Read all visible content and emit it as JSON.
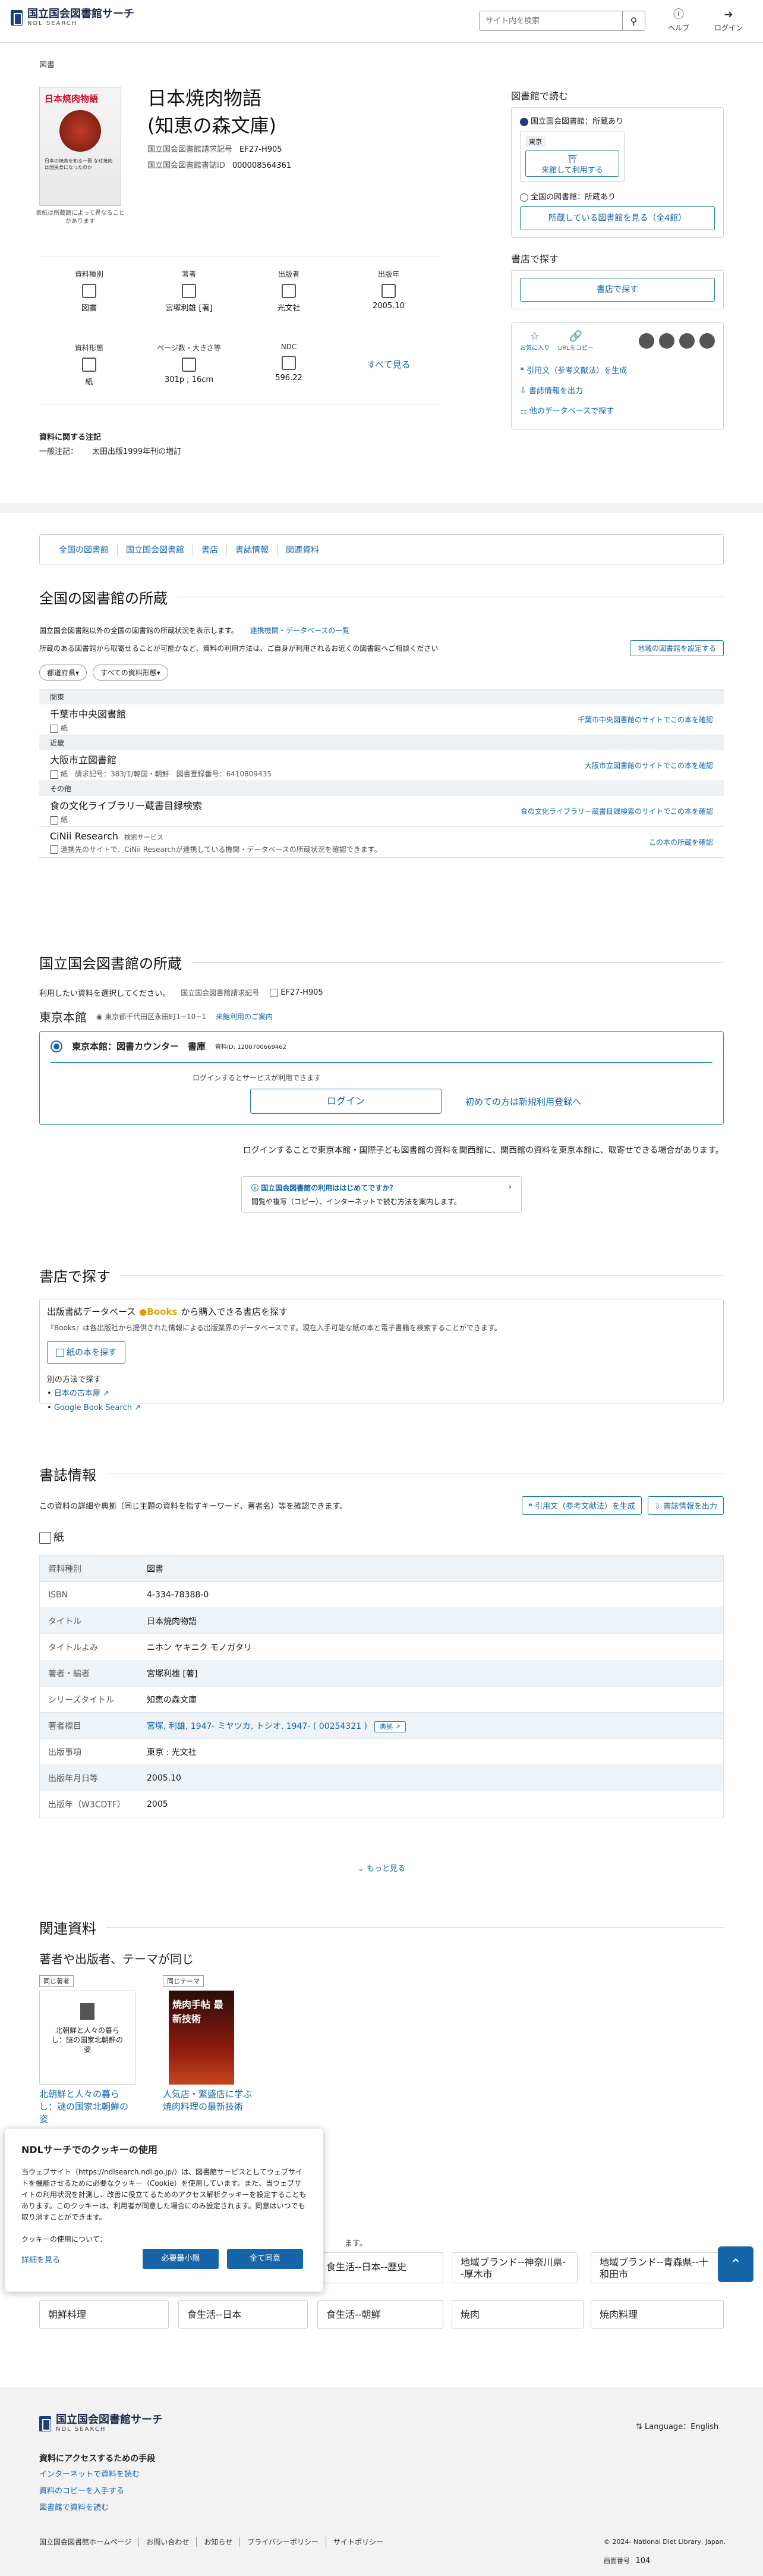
{
  "header": {
    "logo_title": "国立国会図書館サーチ",
    "logo_sub": "NDL SEARCH",
    "search_placeholder": "サイト内を検索",
    "help": "ヘルプ",
    "login": "ログイン"
  },
  "item": {
    "category": "図書",
    "title_line1": "日本焼肉物語",
    "title_line2": "(知恵の森文庫)",
    "call_label": "国立国会図書館請求記号",
    "call_value": "EF27-H905",
    "id_label": "国立国会図書館書誌ID",
    "id_value": "000008564361",
    "cover_note": "表紙は所蔵館によって異なることがあります",
    "cover_title": "日本焼肉物語",
    "cover_sub": "日本の焼肉を知る一冊 なぜ焼肉は国民食になったのか",
    "facts": [
      {
        "label": "資料種別",
        "value": "図書"
      },
      {
        "label": "著者",
        "value": "宮塚利雄 [著]"
      },
      {
        "label": "出版者",
        "value": "光文社"
      },
      {
        "label": "出版年",
        "value": "2005.10"
      },
      {
        "label": "資料形態",
        "value": "紙"
      },
      {
        "label": "ページ数・大きさ等",
        "value": "301p ; 16cm"
      },
      {
        "label": "NDC",
        "value": "596.22"
      }
    ],
    "see_all": "すべて見る",
    "notes_heading": "資料に関する注記",
    "notes_label": "一般注記：",
    "notes_value": "太田出版1999年刊の増訂"
  },
  "side": {
    "read_heading": "図書館で読む",
    "ndl_holding": "国立国会図書館：所蔵あり",
    "tokyo_tag": "東京",
    "visit_button": "来館して利用する",
    "national_holding": "全国の図書館：所蔵あり",
    "national_button": "所蔵している図書館を見る（全4館）",
    "shop_heading": "書店で探す",
    "shop_button": "書店で探す",
    "share_star": "お気に入り",
    "share_url": "URLをコピー",
    "links": [
      "引用文（参考文献法）を生成",
      "書誌情報を出力",
      "他のデータベースで探す"
    ]
  },
  "tabs": [
    "全国の図書館",
    "国立国会図書館",
    "書店",
    "書誌情報",
    "関連資料"
  ],
  "national": {
    "heading": "全国の図書館の所蔵",
    "desc": "国立国会図書館以外の全国の図書館の所蔵状況を表示します。",
    "desc_link": "連携機関・データベースの一覧",
    "desc2": "所蔵のある図書館から取寄せることが可能かなど、資料の利用方法は、ご自身が利用されるお近くの図書館へご相談ください",
    "region_button": "地域の図書館を設定する",
    "filter1": "都道府県▾",
    "filter2": "すべての資料形態▾",
    "groups": [
      {
        "group": "関東",
        "name": "千葉市中央図書館",
        "sub": "紙",
        "link": "千葉市中央図書館のサイトでこの本を確認"
      },
      {
        "group": "近畿",
        "name": "大阪市立図書館",
        "sub": "紙　請求記号：383/1/韓国・朝鮮　図書登録番号：6410809435",
        "link": "大阪市立図書館のサイトでこの本を確認"
      },
      {
        "group": "その他",
        "name": "食の文化ライブラリー蔵書目録検索",
        "sub": "紙",
        "link": "食の文化ライブラリー蔵書目録検索のサイトでこの本を確認"
      },
      {
        "group": "",
        "name": "CiNii Research",
        "sub": "連携先のサイトで、CiNii Researchが連携している機関・データベースの所蔵状況を確認できます。",
        "link": "この本の所蔵を確認",
        "badge": "検索サービス"
      }
    ]
  },
  "ndl": {
    "heading": "国立国会図書館の所蔵",
    "instruction": "利用したい資料を選択してください。",
    "call_label": "国立国会図書館請求記号",
    "call_value": "EF27-H905",
    "branch": "東京本館",
    "address": "東京都千代田区永田町1−10−1",
    "visit_info": "来館利用のご案内",
    "option_title": "東京本館：図書カウンター　書庫",
    "option_id": "資料ID: 1200700669462",
    "login_hint": "ログインするとサービスが利用できます",
    "login_button": "ログイン",
    "register_link": "初めての方は新規利用登録へ",
    "note": "ログインすることで東京本館・国際子ども図書館の資料を関西館に、関西館の資料を東京本館に、取寄せできる場合があります。",
    "guide_title": "国立国会図書館の利用ははじめてですか？",
    "guide_text": "閲覧や複写（コピー）、インターネットで読む方法を案内します。"
  },
  "shop": {
    "heading": "書店で探す",
    "db_title": "出版書誌データベース",
    "db_brand": "Books",
    "db_suffix": "から購入できる書店を探す",
    "db_desc": "『Books』は各出版社から提供された情報による出版業界のデータベースです。現在入手可能な紙の本と電子書籍を検索することができます。",
    "paper_button": "紙の本を探す",
    "alt_heading": "別の方法で探す",
    "alt_links": [
      "日本の古本屋",
      "Google Book Search"
    ]
  },
  "biblio": {
    "heading": "書誌情報",
    "desc": "この資料の詳細や典拠（同じ主題の資料を指すキーワード、著者名）等を確認できます。",
    "cite_button": "引用文（参考文献法）を生成",
    "export_button": "書誌情報を出力",
    "format": "紙",
    "rows": [
      {
        "k": "資料種別",
        "v": "図書"
      },
      {
        "k": "ISBN",
        "v": "4-334-78388-0"
      },
      {
        "k": "タイトル",
        "v": "日本焼肉物語"
      },
      {
        "k": "タイトルよみ",
        "v": "ニホン ヤキニク モノガタリ"
      },
      {
        "k": "著者・編者",
        "v": "宮塚利雄 [著]"
      },
      {
        "k": "シリーズタイトル",
        "v": "知恵の森文庫"
      },
      {
        "k": "著者標目",
        "v": "宮塚, 利雄, 1947- ミヤツカ, トシオ, 1947- ( 00254321 )",
        "badge": "典拠"
      },
      {
        "k": "出版事項",
        "v": "東京 : 光文社"
      },
      {
        "k": "出版年月日等",
        "v": "2005.10"
      },
      {
        "k": "出版年（W3CDTF）",
        "v": "2005"
      }
    ],
    "more": "もっと見る"
  },
  "related": {
    "heading": "関連資料",
    "subheading": "著者や出版者、テーマが同じ",
    "items": [
      {
        "tag": "同じ著者",
        "cover_text": "北朝鮮と人々の暮らし：謎の国家北朝鮮の姿",
        "title": "北朝鮮と人々の暮らし：謎の国家北朝鮮の姿"
      },
      {
        "tag": "同じテーマ",
        "cover_text": "焼肉手帖 最新技術",
        "title": "人気店・繁盛店に学ぶ焼肉料理の最新技術"
      }
    ],
    "subjects_row1": [
      "食生活--日本--歴史",
      "地域ブランド--神奈川県--厚木市",
      "地域ブランド--青森県--十和田市"
    ],
    "subjects_row2": [
      "朝鮮料理",
      "食生活--日本",
      "食生活--朝鮮",
      "焼肉",
      "焼肉料理"
    ],
    "subjects_tail": "ます。"
  },
  "cookie": {
    "title": "NDLサーチでのクッキーの使用",
    "body": "当ウェブサイト（https://ndlsearch.ndl.go.jp/）は、図書館サービスとしてウェブサイトを機能させるために必要なクッキー（Cookie）を使用しています。また、当ウェブサイトの利用状況を計測し、改善に役立てるためのアクセス解析クッキーを設定することもあります。このクッキーは、利用者が同意した場合にのみ設定されます。同意はいつでも取り消すことができます。",
    "usage": "クッキーの使用について：",
    "detail": "詳細を見る",
    "necessary": "必要最小限",
    "accept": "全て同意"
  },
  "footer": {
    "logo_title": "国立国会図書館サーチ",
    "logo_sub": "NDL SEARCH",
    "language": "Language：English",
    "access_heading": "資料にアクセスするための手段",
    "access_links": [
      "インターネットで資料を読む",
      "資料のコピーを入手する",
      "図書館で資料を読む"
    ],
    "bottom_links": [
      "国立国会図書館ホームページ",
      "お問い合わせ",
      "お知らせ",
      "プライバシーポリシー",
      "サイトポリシー"
    ],
    "copyright": "© 2024- National Diet Library, Japan.",
    "screen_label": "画面番号",
    "screen_num": "104"
  },
  "colors": {
    "accent": "#1565a8",
    "fill": "#1565a8"
  }
}
